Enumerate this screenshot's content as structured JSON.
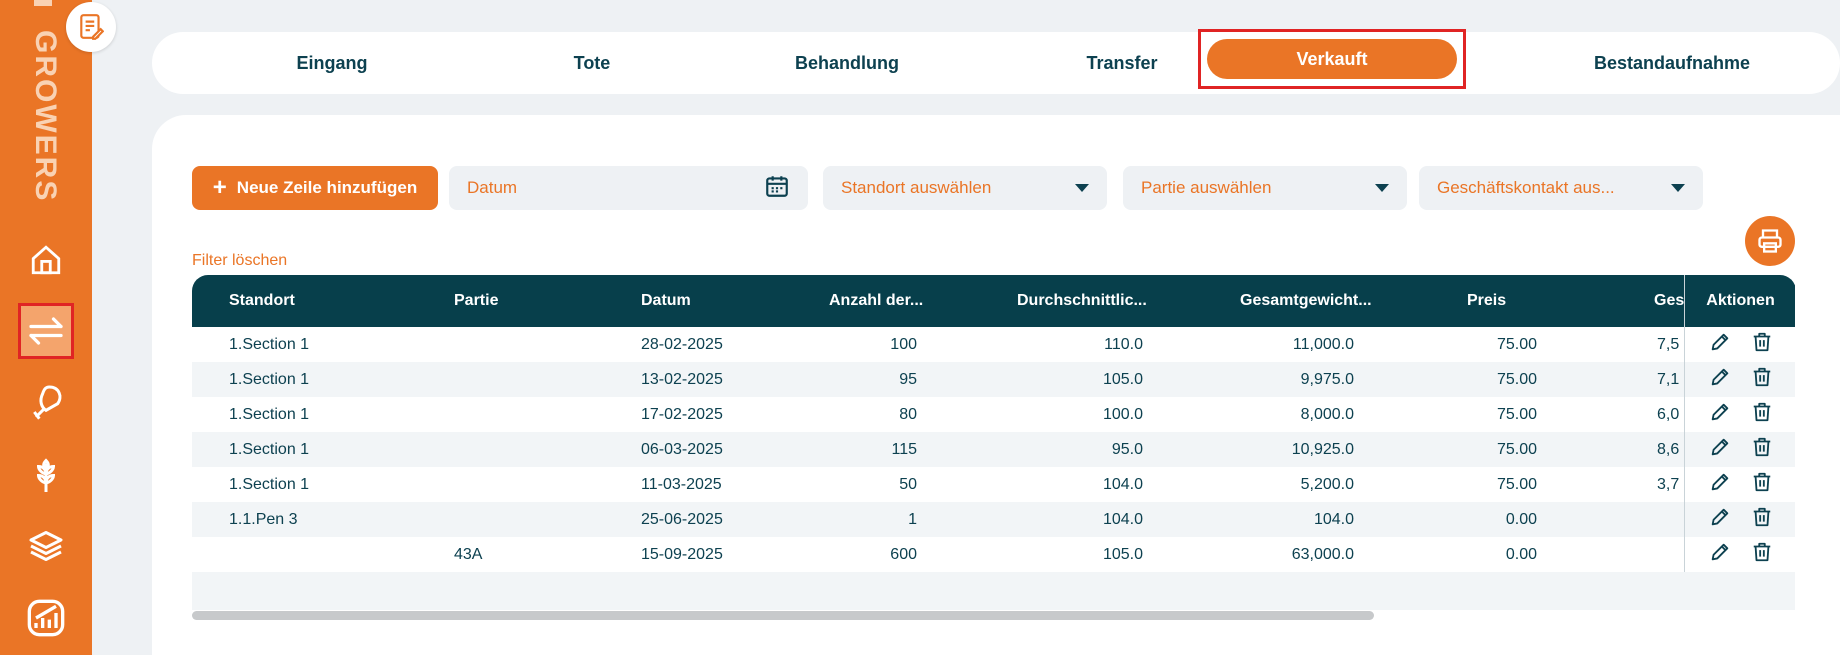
{
  "sidebar": {
    "brand": "GROWERS",
    "items": [
      {
        "icon": "home-icon"
      },
      {
        "icon": "transfer-arrows-icon",
        "active": true
      },
      {
        "icon": "meat-icon"
      },
      {
        "icon": "grain-icon"
      },
      {
        "icon": "layers-icon"
      },
      {
        "icon": "chart-icon"
      }
    ]
  },
  "tabs": [
    "Eingang",
    "Tote",
    "Behandlung",
    "Transfer",
    "Verkauft",
    "Bestandaufnahme"
  ],
  "active_tab": "Verkauft",
  "toolbar": {
    "add_label": "Neue Zeile hinzufügen",
    "date_placeholder": "Datum",
    "location_placeholder": "Standort auswählen",
    "batch_placeholder": "Partie auswählen",
    "contact_placeholder": "Geschäftskontakt aus...",
    "clear_filter": "Filter löschen"
  },
  "table": {
    "columns": [
      "Standort",
      "Partie",
      "Datum",
      "Anzahl der...",
      "Durchschnittlic...",
      "Gesamtgewicht...",
      "Preis",
      "Ges"
    ],
    "actions_header": "Aktionen",
    "rows": [
      {
        "standort": "1.Section 1",
        "partie": "",
        "datum": "28-02-2025",
        "anzahl": "100",
        "avg": "110.0",
        "total": "11,000.0",
        "preis": "75.00",
        "ges": "7,5"
      },
      {
        "standort": "1.Section 1",
        "partie": "",
        "datum": "13-02-2025",
        "anzahl": "95",
        "avg": "105.0",
        "total": "9,975.0",
        "preis": "75.00",
        "ges": "7,1"
      },
      {
        "standort": "1.Section 1",
        "partie": "",
        "datum": "17-02-2025",
        "anzahl": "80",
        "avg": "100.0",
        "total": "8,000.0",
        "preis": "75.00",
        "ges": "6,0"
      },
      {
        "standort": "1.Section 1",
        "partie": "",
        "datum": "06-03-2025",
        "anzahl": "115",
        "avg": "95.0",
        "total": "10,925.0",
        "preis": "75.00",
        "ges": "8,6"
      },
      {
        "standort": "1.Section 1",
        "partie": "",
        "datum": "11-03-2025",
        "anzahl": "50",
        "avg": "104.0",
        "total": "5,200.0",
        "preis": "75.00",
        "ges": "3,7"
      },
      {
        "standort": "1.1.Pen 3",
        "partie": "",
        "datum": "25-06-2025",
        "anzahl": "1",
        "avg": "104.0",
        "total": "104.0",
        "preis": "0.00",
        "ges": ""
      },
      {
        "standort": "",
        "partie": "43A",
        "datum": "15-09-2025",
        "anzahl": "600",
        "avg": "105.0",
        "total": "63,000.0",
        "preis": "0.00",
        "ges": ""
      }
    ]
  },
  "colors": {
    "accent": "#ea7526",
    "header": "#073f4b",
    "text": "#0d4150",
    "highlight": "#e02424"
  }
}
